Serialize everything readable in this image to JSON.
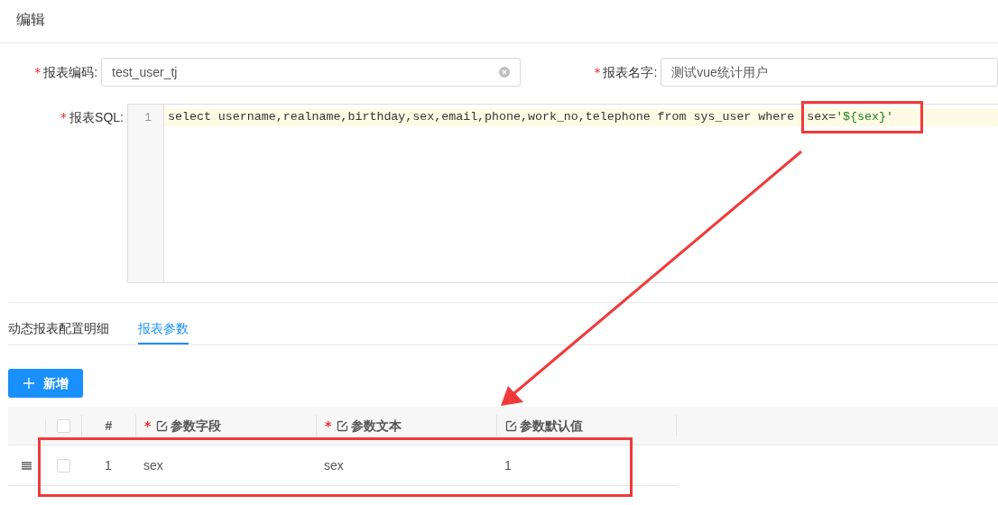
{
  "modal": {
    "title": "编辑"
  },
  "fields": [
    {
      "label": "报表编码:",
      "required_mark": "*",
      "value": "test_user_tj",
      "clearable": true
    },
    {
      "label": "报表名字:",
      "required_mark": "*",
      "value": "测试vue统计用户",
      "clearable": false
    }
  ],
  "sql_editor": {
    "label": "报表SQL:",
    "required_mark": "*",
    "lines": [
      {
        "number": "1",
        "active": true,
        "tokens": [
          {
            "text": "select username,realname,birthday,sex,email,phone,work_no,telephone from sys_user where ",
            "kind": "plain"
          }
        ],
        "framed_tokens": [
          {
            "text": "sex=",
            "kind": "plain"
          },
          {
            "text": "'${sex}'",
            "kind": "string"
          }
        ]
      }
    ]
  },
  "tabs": [
    {
      "label": "动态报表配置明细",
      "selected": false
    },
    {
      "label": "报表参数",
      "selected": true
    }
  ],
  "add_button": {
    "label": "新增"
  },
  "table": {
    "all_checked": false,
    "columns": [
      {
        "label": "#"
      },
      {
        "label": "参数字段",
        "required_mark": "*",
        "editable": true
      },
      {
        "label": "参数文本",
        "required_mark": "*",
        "editable": true
      },
      {
        "label": "参数默认值",
        "editable": true
      }
    ],
    "rows": [
      {
        "checked": false,
        "cells": [
          "1",
          "sex",
          "sex",
          "1"
        ]
      }
    ]
  },
  "annotations": {
    "arrow": true,
    "row_frame": true
  }
}
